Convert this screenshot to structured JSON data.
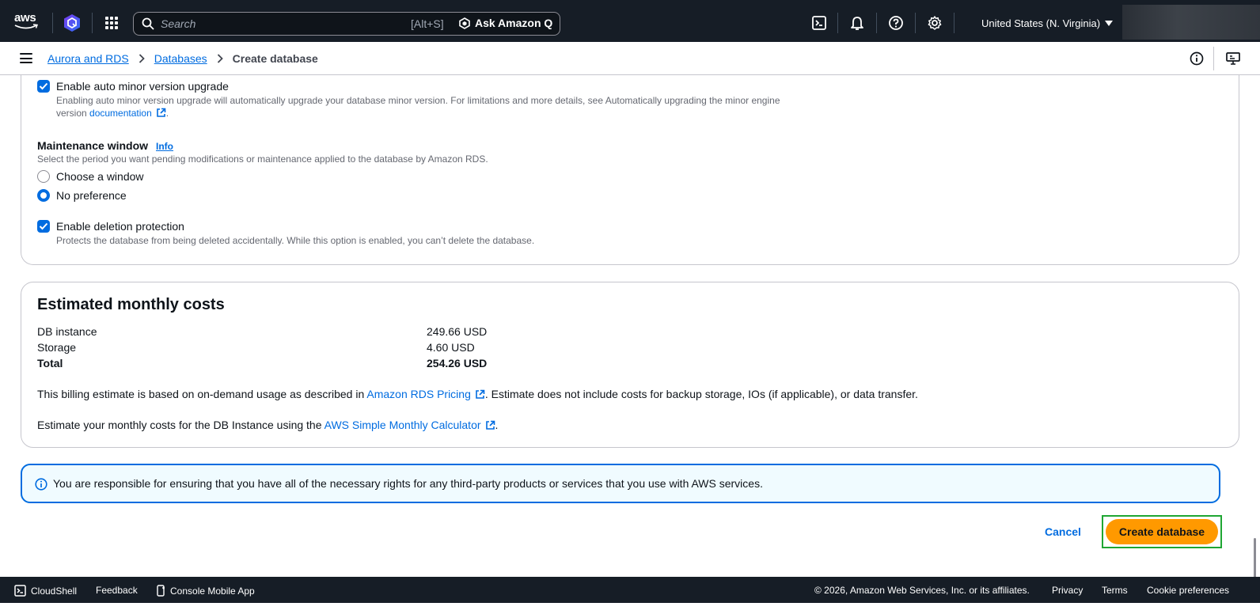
{
  "topnav": {
    "logo_text": "aws",
    "search_placeholder": "Search",
    "search_shortcut": "[Alt+S]",
    "ask_q_label": "Ask Amazon Q",
    "region": "United States (N. Virginia)"
  },
  "breadcrumb": {
    "items": [
      "Aurora and RDS",
      "Databases"
    ],
    "current": "Create database"
  },
  "maintenance": {
    "auto_minor_label": "Enable auto minor version upgrade",
    "auto_minor_desc_line1": "Enabling auto minor version upgrade will automatically upgrade your database minor version. For limitations and more details, see Automatically upgrading the minor engine",
    "auto_minor_desc_line2_prefix": "version",
    "auto_minor_desc_link": "documentation",
    "auto_minor_desc_suffix": ".",
    "window_heading": "Maintenance window",
    "info_link": "Info",
    "window_desc": "Select the period you want pending modifications or maintenance applied to the database by Amazon RDS.",
    "options": [
      "Choose a window",
      "No preference"
    ],
    "selected_option": "No preference",
    "deletion_label": "Enable deletion protection",
    "deletion_desc": "Protects the database from being deleted accidentally. While this option is enabled, you can’t delete the database."
  },
  "costs": {
    "title": "Estimated monthly costs",
    "rows": [
      {
        "label": "DB instance",
        "value": "249.66 USD"
      },
      {
        "label": "Storage",
        "value": "4.60 USD"
      },
      {
        "label": "Total",
        "value": "254.26 USD"
      }
    ],
    "billing_prefix": "This billing estimate is based on on-demand usage as described in",
    "billing_link": "Amazon RDS Pricing",
    "billing_suffix": ". Estimate does not include costs for backup storage, IOs (if applicable), or data transfer.",
    "calc_prefix": "Estimate your monthly costs for the DB Instance using the",
    "calc_link": "AWS Simple Monthly Calculator",
    "calc_suffix": "."
  },
  "alert": {
    "text": "You are responsible for ensuring that you have all of the necessary rights for any third-party products or services that you use with AWS services."
  },
  "actions": {
    "cancel": "Cancel",
    "create": "Create database"
  },
  "footer": {
    "cloudshell": "CloudShell",
    "feedback": "Feedback",
    "mobile_app": "Console Mobile App",
    "copyright": "© 2026, Amazon Web Services, Inc. or its affiliates.",
    "privacy": "Privacy",
    "terms": "Terms",
    "cookies": "Cookie preferences"
  },
  "colors": {
    "nav_bg": "#161d26",
    "link": "#006ce0",
    "primary_button": "#ff9900",
    "focus_outline": "#1fa633",
    "alert_bg": "#f0fbff"
  }
}
